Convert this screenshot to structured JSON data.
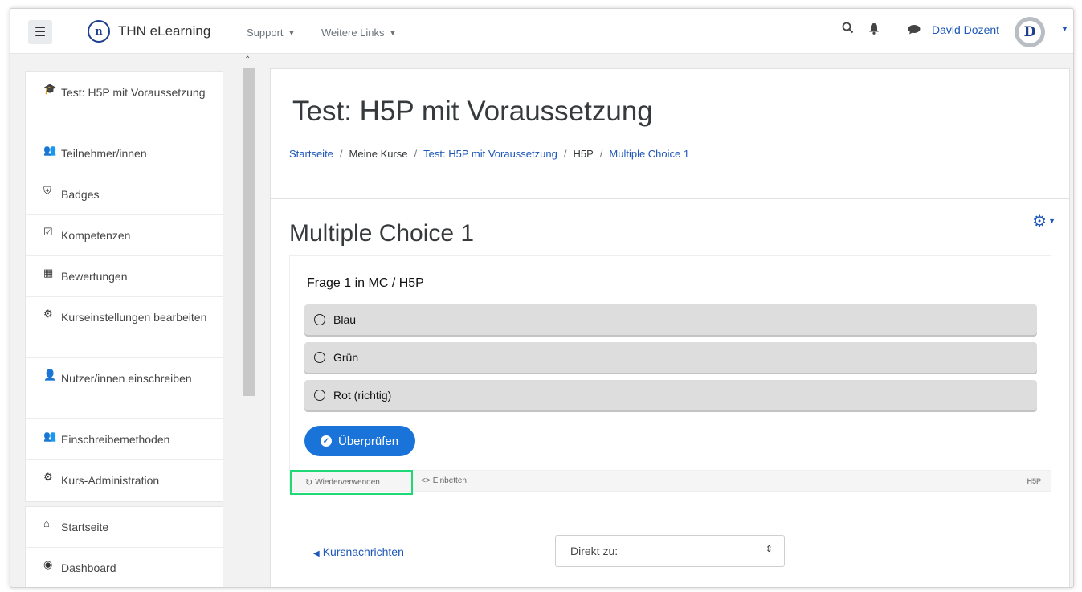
{
  "navbar": {
    "site_name": "THN eLearning",
    "logo_text": "n",
    "links": [
      {
        "label": "Support"
      },
      {
        "label": "Weitere Links"
      }
    ],
    "user_name": "David Dozent",
    "avatar_initial": "D"
  },
  "sidebar": {
    "course_items": [
      {
        "icon": "graduation-cap-icon",
        "label": "Test: H5P mit Voraussetzung"
      },
      {
        "icon": "users-icon",
        "label": "Teilnehmer/innen"
      },
      {
        "icon": "shield-icon",
        "label": "Badges"
      },
      {
        "icon": "checkbox-icon",
        "label": "Kompetenzen"
      },
      {
        "icon": "table-icon",
        "label": "Bewertungen"
      },
      {
        "icon": "gear-icon",
        "label": "Kurseinstellungen bearbeiten"
      },
      {
        "icon": "user-plus-icon",
        "label": "Nutzer/innen einschreiben"
      },
      {
        "icon": "users-icon",
        "label": "Einschreibemethoden"
      },
      {
        "icon": "gear-icon",
        "label": "Kurs-Administration"
      }
    ],
    "site_items": [
      {
        "icon": "home-icon",
        "label": "Startseite"
      },
      {
        "icon": "dashboard-icon",
        "label": "Dashboard"
      }
    ]
  },
  "header": {
    "title": "Test: H5P mit Voraussetzung",
    "breadcrumb": [
      {
        "label": "Startseite",
        "link": true
      },
      {
        "label": "Meine Kurse",
        "link": false
      },
      {
        "label": "Test: H5P mit Voraussetzung",
        "link": true
      },
      {
        "label": "H5P",
        "link": false
      },
      {
        "label": "Multiple Choice 1",
        "link": true
      }
    ]
  },
  "activity": {
    "title": "Multiple Choice 1",
    "question": "Frage 1 in MC / H5P",
    "answers": [
      "Blau",
      "Grün",
      "Rot (richtig)"
    ],
    "check_label": "Überprüfen",
    "reuse_label": "Wiederverwenden",
    "embed_label": "Einbetten",
    "h5p_logo": "H5P",
    "prev_link": "Kursnachrichten",
    "jump_placeholder": "Direkt zu:"
  },
  "colors": {
    "link": "#1d57b8",
    "primary_button": "#1a73d9",
    "highlight_border": "#1fd876"
  }
}
